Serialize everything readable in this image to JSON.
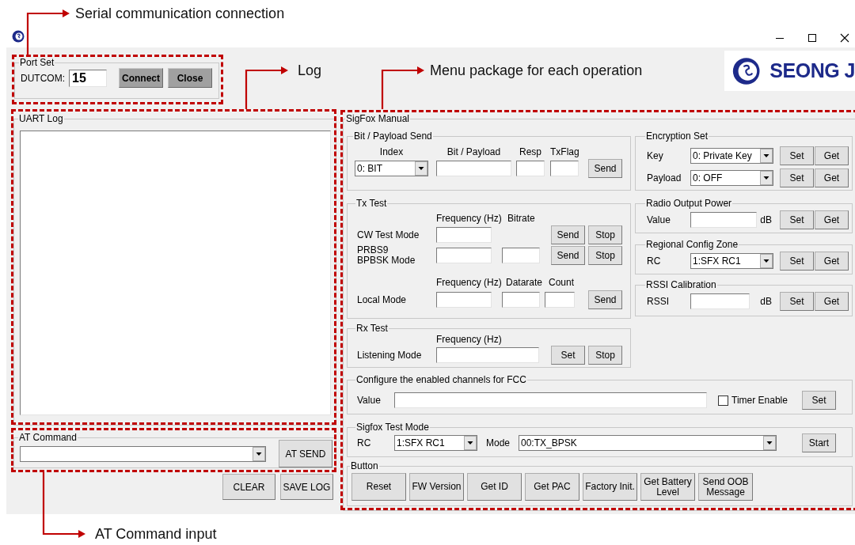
{
  "annotations": [
    {
      "text": "Serial communication connection"
    },
    {
      "text": "Log"
    },
    {
      "text": "Menu package for each operation"
    },
    {
      "text": "AT Command input"
    }
  ],
  "logo": {
    "text": "SEONG J"
  },
  "port_set": {
    "title": "Port Set",
    "label": "DUTCOM:",
    "value": "15",
    "buttons": [
      "Connect",
      "Close"
    ]
  },
  "uart_log": {
    "title": "UART Log"
  },
  "at_command": {
    "title": "AT Command",
    "button": "AT SEND"
  },
  "log_buttons": [
    "CLEAR",
    "SAVE LOG"
  ],
  "sigfox_manual": {
    "title": "SigFox Manual"
  },
  "bit_payload_send": {
    "title": "Bit / Payload Send",
    "headers": [
      "Index",
      "Bit / Payload",
      "Resp",
      "TxFlag"
    ],
    "index_value": "0: BIT",
    "button": "Send"
  },
  "encryption_set": {
    "title": "Encryption Set",
    "rows": [
      {
        "label": "Key",
        "value": "0: Private Key",
        "buttons": [
          "Set",
          "Get"
        ]
      },
      {
        "label": "Payload",
        "value": "0: OFF",
        "buttons": [
          "Set",
          "Get"
        ]
      }
    ]
  },
  "tx_test": {
    "title": "Tx Test",
    "headers_1": [
      "Frequency (Hz)",
      "Bitrate"
    ],
    "cw_label": "CW Test Mode",
    "cw_buttons": [
      "Send",
      "Stop"
    ],
    "prbs_label": "PRBS9\nBPBSK Mode",
    "prbs_buttons": [
      "Send",
      "Stop"
    ],
    "headers_2": [
      "Frequency (Hz)",
      "Datarate",
      "Count"
    ],
    "local_label": "Local Mode",
    "local_button": "Send"
  },
  "radio_output_power": {
    "title": "Radio Output Power",
    "label": "Value",
    "unit": "dB",
    "buttons": [
      "Set",
      "Get"
    ]
  },
  "regional_config_zone": {
    "title": "Regional Config Zone",
    "label": "RC",
    "value": "1:SFX RC1",
    "buttons": [
      "Set",
      "Get"
    ]
  },
  "rssi_calibration": {
    "title": "RSSI Calibration",
    "label": "RSSI",
    "unit": "dB",
    "buttons": [
      "Set",
      "Get"
    ]
  },
  "rx_test": {
    "title": "Rx Test",
    "header": "Frequency (Hz)",
    "label": "Listening Mode",
    "buttons": [
      "Set",
      "Stop"
    ]
  },
  "fcc_channels": {
    "title": "Configure the enabled channels for FCC",
    "label": "Value",
    "timer_enable": {
      "label": "Timer Enable",
      "checked": false
    },
    "button": "Set"
  },
  "sigfox_test_mode": {
    "title": "Sigfox Test Mode",
    "rc_label": "RC",
    "rc_value": "1:SFX RC1",
    "mode_label": "Mode",
    "mode_value": "00:TX_BPSK",
    "button": "Start"
  },
  "button_panel": {
    "title": "Button",
    "buttons": [
      "Reset",
      "FW Version",
      "Get ID",
      "Get PAC",
      "Factory Init.",
      "Get Battery Level",
      "Send OOB Message"
    ]
  }
}
